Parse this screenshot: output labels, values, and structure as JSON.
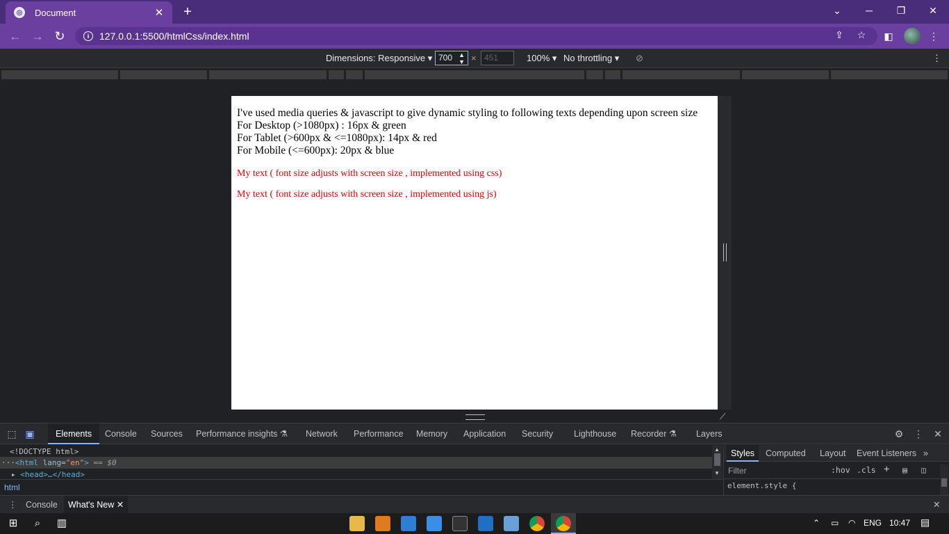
{
  "browser": {
    "tab_title": "Document",
    "url": "127.0.0.1:5500/htmlCss/index.html",
    "favicon_letter": "◎"
  },
  "device_toolbar": {
    "dimensions_label": "Dimensions: Responsive",
    "width_value": "700",
    "height_value": "451",
    "zoom_label": "100%",
    "throttling_label": "No throttling"
  },
  "page": {
    "intro_line1": "I've used media queries & javascript to give dynamic styling to following texts depending upon screen size",
    "intro_line2": "For Desktop (>1080px) : 16px & green",
    "intro_line3": "For Tablet (>600px & <=1080px): 14px & red",
    "intro_line4": "For Mobile (<=600px): 20px & blue",
    "css_text": "My text ( font size adjusts with screen size , implemented using css)",
    "js_text": "My text ( font size adjusts with screen size , implemented using js)"
  },
  "devtools": {
    "tabs": [
      "Elements",
      "Console",
      "Sources",
      "Performance insights",
      "Network",
      "Performance",
      "Memory",
      "Application",
      "Security",
      "Lighthouse",
      "Recorder",
      "Layers"
    ],
    "code_doctype": "<!DOCTYPE html>",
    "code_html_open": "<html",
    "code_lang_attr": "lang",
    "code_lang_val": "\"en\"",
    "code_html_close": ">",
    "code_ref": "== $0",
    "code_head": "<head>…</head>",
    "breadcrumb": "html",
    "styles_tabs": [
      "Styles",
      "Computed",
      "Layout",
      "Event Listeners"
    ],
    "filter_placeholder": "Filter",
    "hov_label": ":hov",
    "cls_label": ".cls",
    "element_style": "element.style {"
  },
  "drawer": {
    "tabs": [
      "Console",
      "What's New"
    ]
  },
  "taskbar": {
    "language": "ENG",
    "time": "10:47"
  },
  "colors": {
    "title_bar": "#4a2d7a",
    "toolbar": "#6b3fa0",
    "page_red_text": "#e00000",
    "devtools_accent": "#8ab4f8"
  }
}
